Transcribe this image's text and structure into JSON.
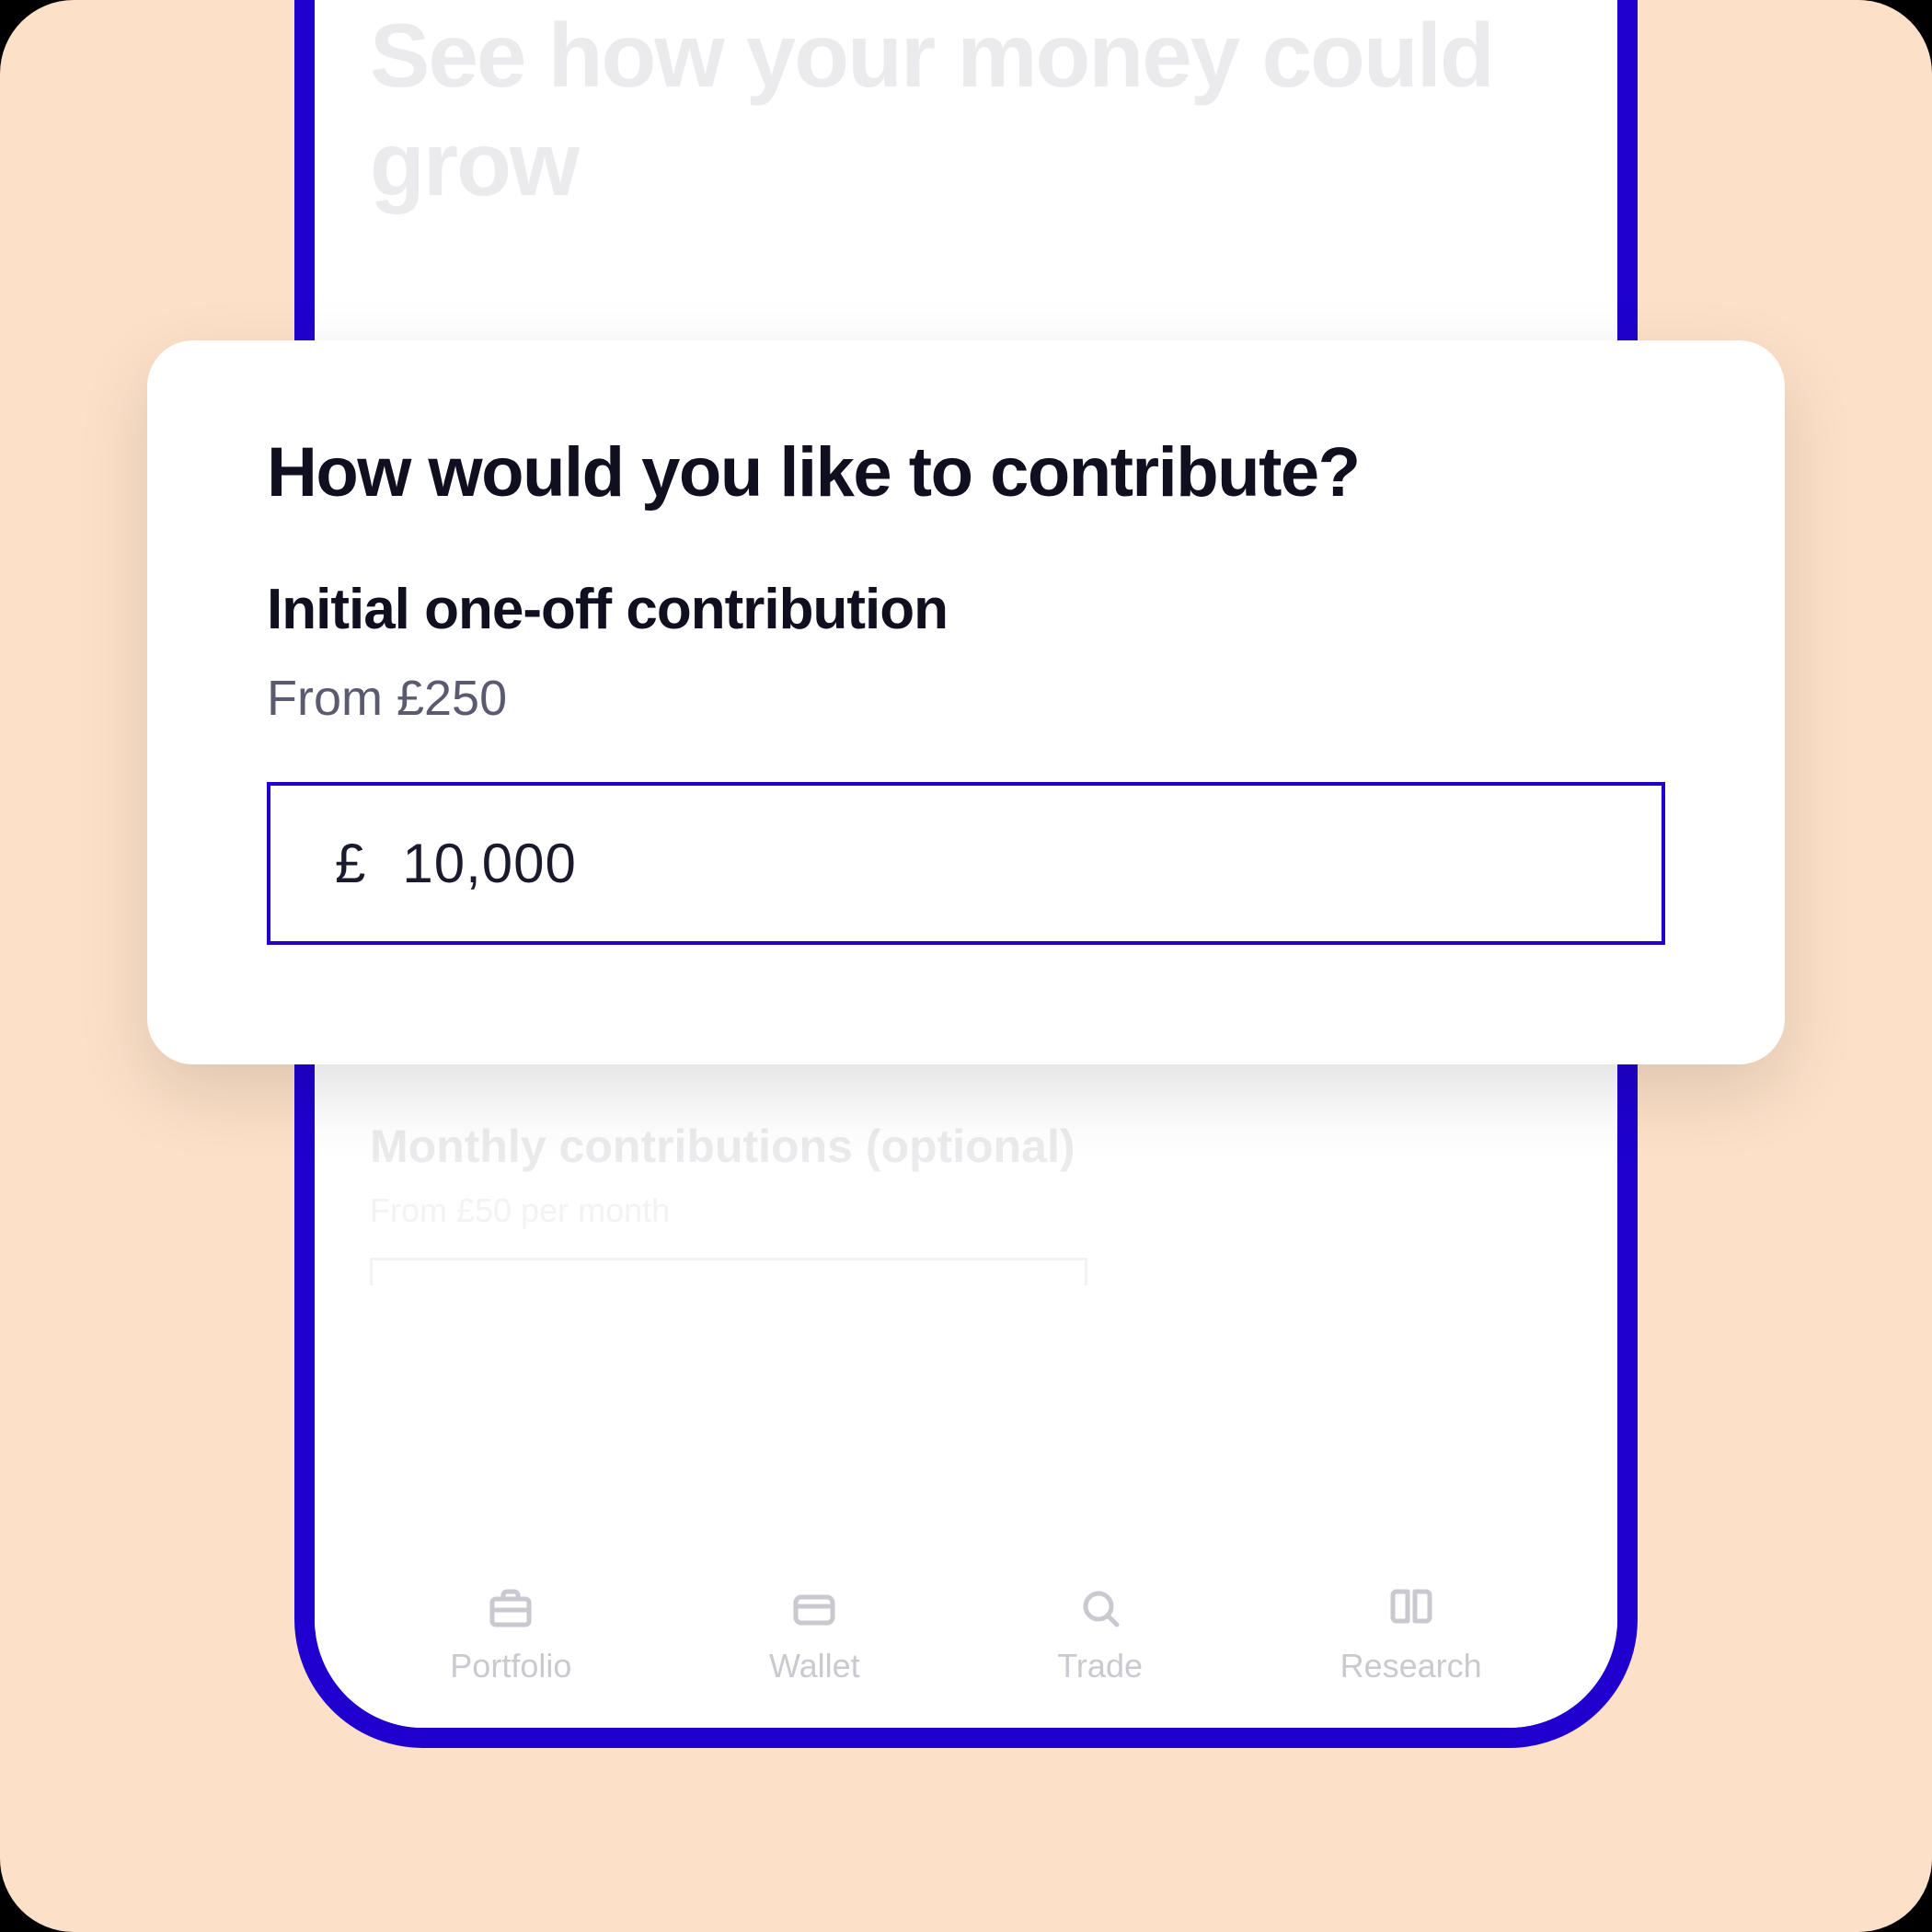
{
  "colors": {
    "accent": "#1F00CE",
    "background": "#FCE0C8",
    "muted": "#DADADF"
  },
  "background": {
    "heading": "See how your money could grow",
    "monthly": {
      "heading": "Monthly contributions (optional)",
      "subtext": "From £50 per month"
    }
  },
  "modal": {
    "title": "How would you like to contribute?",
    "initial": {
      "heading": "Initial one-off contribution",
      "subtext": "From £250",
      "currency_symbol": "£",
      "value": "10,000"
    }
  },
  "nav": {
    "items": [
      {
        "icon": "briefcase-icon",
        "label": "Portfolio"
      },
      {
        "icon": "wallet-icon",
        "label": "Wallet"
      },
      {
        "icon": "search-icon",
        "label": "Trade"
      },
      {
        "icon": "book-icon",
        "label": "Research"
      }
    ]
  }
}
